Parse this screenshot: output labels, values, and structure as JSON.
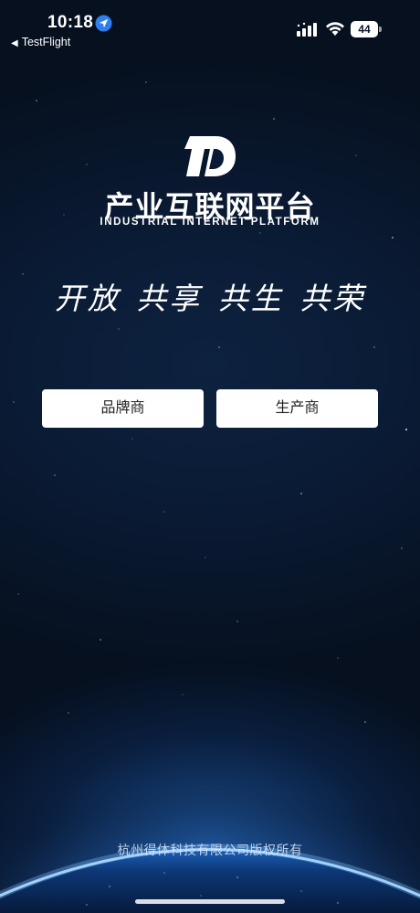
{
  "status_bar": {
    "time": "10:18",
    "back_app": "TestFlight",
    "battery": "44"
  },
  "logo": {
    "title": "产业互联网平台",
    "subtitle": "INDUSTRIAL INTERNET PLATFORM"
  },
  "slogan": "开放 共享 共生 共荣",
  "buttons": {
    "brand_label": "品牌商",
    "manufacturer_label": "生产商"
  },
  "footer": {
    "copyright": "杭州得体科技有限公司版权所有"
  },
  "colors": {
    "background": "#06101f",
    "earth_glow": "#3a8ef0",
    "button_bg": "#ffffff"
  }
}
